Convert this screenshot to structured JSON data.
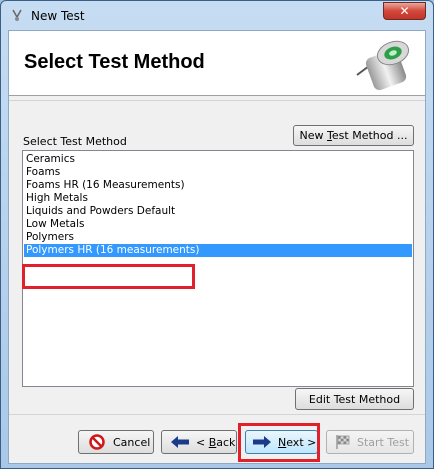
{
  "window": {
    "title": "New Test",
    "close_label": "✕"
  },
  "header": {
    "title": "Select Test Method",
    "image_icon": "sensor-probe-icon"
  },
  "method_list": {
    "label": "Select Test Method",
    "new_button": {
      "pre": "New ",
      "underlined": "T",
      "post": "est Method ..."
    },
    "items": [
      "Ceramics",
      "Foams",
      "Foams HR (16 Measurements)",
      "High Metals",
      "Liquids and Powders Default",
      "Low Metals",
      "Polymers",
      "Polymers HR (16 measurements)"
    ],
    "selected_index": 7,
    "edit_button": "Edit Test Method"
  },
  "buttons": {
    "cancel": "Cancel",
    "back": {
      "pre": "< ",
      "underlined": "B",
      "post": "ack"
    },
    "next": {
      "underlined": "N",
      "post": "ext >"
    },
    "start": "Start Test"
  },
  "icons": {
    "cancel": "no-entry-icon",
    "back": "arrow-left-icon",
    "next": "arrow-right-icon",
    "start": "checkered-flag-icon"
  },
  "colors": {
    "selection": "#3399ff",
    "highlight_box": "#e0202a"
  }
}
